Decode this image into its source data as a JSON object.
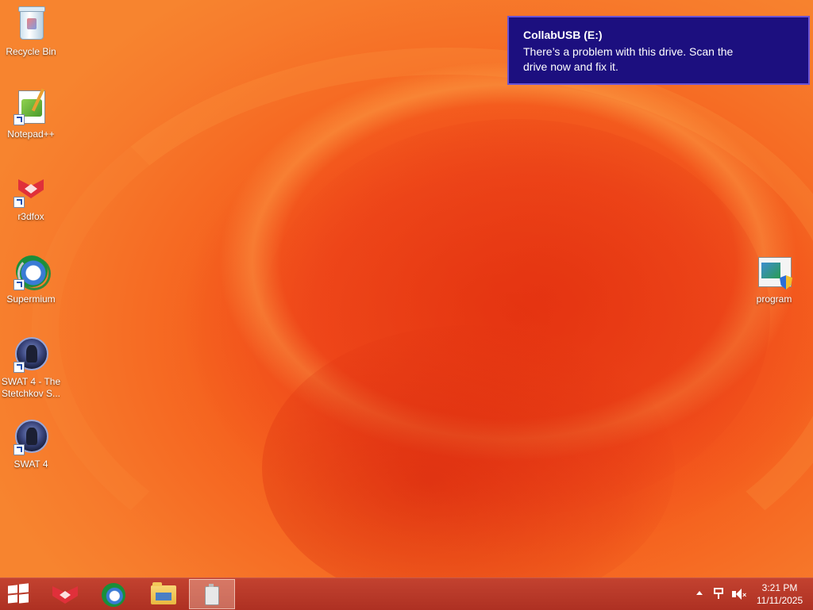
{
  "desktop": {
    "icons": [
      {
        "label": "Recycle Bin",
        "icon": "recycle-bin-icon"
      },
      {
        "label": "Notepad++",
        "icon": "notepad-plus-plus-icon"
      },
      {
        "label": "r3dfox",
        "icon": "r3dfox-icon"
      },
      {
        "label": "Supermium",
        "icon": "supermium-icon"
      },
      {
        "label": "SWAT 4 - The Stetchkov S...",
        "icon": "swat4-expansion-icon"
      },
      {
        "label": "SWAT 4",
        "icon": "swat4-icon"
      },
      {
        "label": "program",
        "icon": "program-installer-icon"
      }
    ]
  },
  "notification": {
    "title": "CollabUSB (E:)",
    "body": "There’s a problem with this drive.  Scan the drive now and fix it.",
    "background": "#1c0f7f"
  },
  "taskbar": {
    "items": [
      {
        "name": "start",
        "icon": "windows-logo-icon"
      },
      {
        "name": "r3dfox",
        "icon": "r3dfox-icon"
      },
      {
        "name": "supermium",
        "icon": "supermium-icon"
      },
      {
        "name": "file-explorer",
        "icon": "folder-icon"
      },
      {
        "name": "usb-drive",
        "icon": "usb-drive-icon",
        "active": true
      }
    ],
    "clock": {
      "time": "3:21 PM",
      "date": "11/11/2025"
    }
  },
  "colors": {
    "taskbar": "#b8321d",
    "wallpaper_primary": "#f2521b"
  }
}
